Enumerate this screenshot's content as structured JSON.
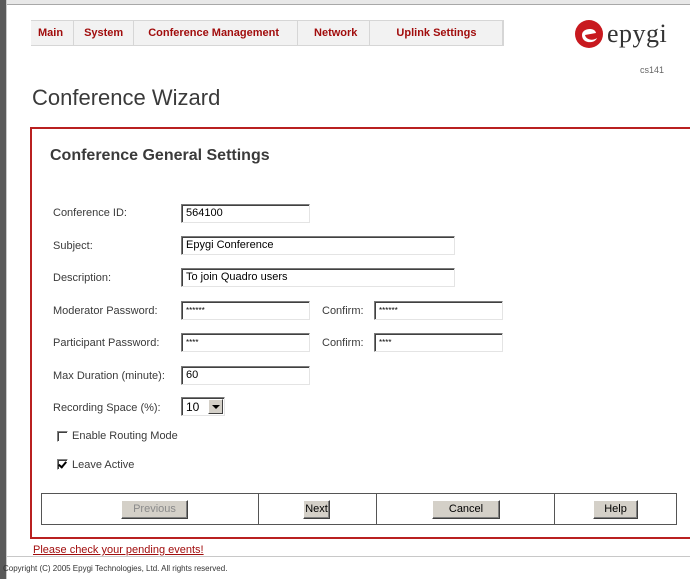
{
  "menu": [
    "Main",
    "System",
    "Conference Management",
    "Network",
    "Uplink Settings"
  ],
  "logo": {
    "text": "epygi",
    "brand_color": "#c8191f"
  },
  "page_code": "cs141",
  "page_title": "Conference Wizard",
  "section_title": "Conference General Settings",
  "form": {
    "conference_id": {
      "label": "Conference ID:",
      "value": "564100"
    },
    "subject": {
      "label": "Subject:",
      "value": "Epygi Conference"
    },
    "description": {
      "label": "Description:",
      "value": "To join Quadro users"
    },
    "moderator_password": {
      "label": "Moderator Password:",
      "value": "******",
      "confirm_label": "Confirm:",
      "confirm_value": "******"
    },
    "participant_password": {
      "label": "Participant Password:",
      "value": "****",
      "confirm_label": "Confirm:",
      "confirm_value": "****"
    },
    "max_duration": {
      "label": "Max Duration (minute):",
      "value": "60"
    },
    "recording_space": {
      "label": "Recording Space (%):",
      "value": "10"
    },
    "enable_routing_mode": {
      "label": "Enable Routing Mode",
      "checked": false
    },
    "leave_active": {
      "label": "Leave Active",
      "checked": true
    }
  },
  "buttons": {
    "previous": "Previous",
    "next": "Next",
    "cancel": "Cancel",
    "help": "Help"
  },
  "pending_events_link": "Please check your pending events!",
  "copyright": "Copyright (C) 2005 Epygi Technologies, Ltd. All rights reserved.",
  "colors": {
    "accent": "#b92020",
    "menu_text": "#a10d0d"
  }
}
